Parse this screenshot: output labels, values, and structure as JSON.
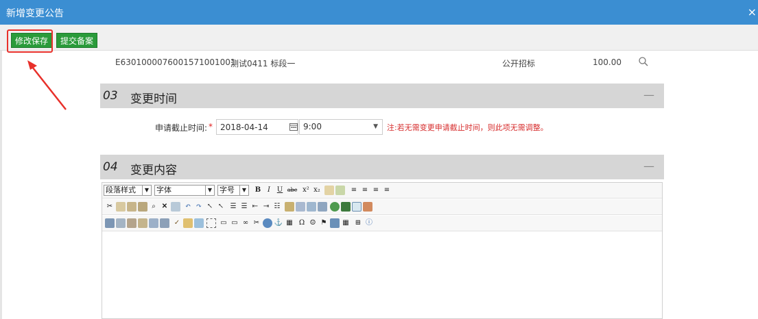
{
  "window": {
    "title": "新增变更公告",
    "close": "×"
  },
  "toolbar": {
    "save_label": "修改保存",
    "submit_label": "提交备案"
  },
  "info": {
    "code": "E6301000076001571001001",
    "project_name": "测试0411 标段一",
    "method": "公开招标",
    "amount": "100.00"
  },
  "section3": {
    "num": "03",
    "title": "变更时间",
    "collapse": "—"
  },
  "deadline": {
    "label": "申请截止时间:",
    "required": "*",
    "date": "2018-04-14",
    "time": "9:00",
    "note": "注:若无需变更申请截止时间，则此项无需调整。"
  },
  "section4": {
    "num": "04",
    "title": "变更内容",
    "collapse": "—"
  },
  "editor": {
    "paragraph_style": "段落样式",
    "font": "字体",
    "font_size": "字号",
    "bold": "B",
    "italic": "I",
    "underline": "U",
    "strike": "abc",
    "superscript": "x²",
    "subscript": "x₂"
  },
  "colors": {
    "titlebar": "#3b8ed2",
    "button_green": "#2a9b3a",
    "highlight_red": "#e8302a",
    "note_red": "#d62b2b"
  }
}
